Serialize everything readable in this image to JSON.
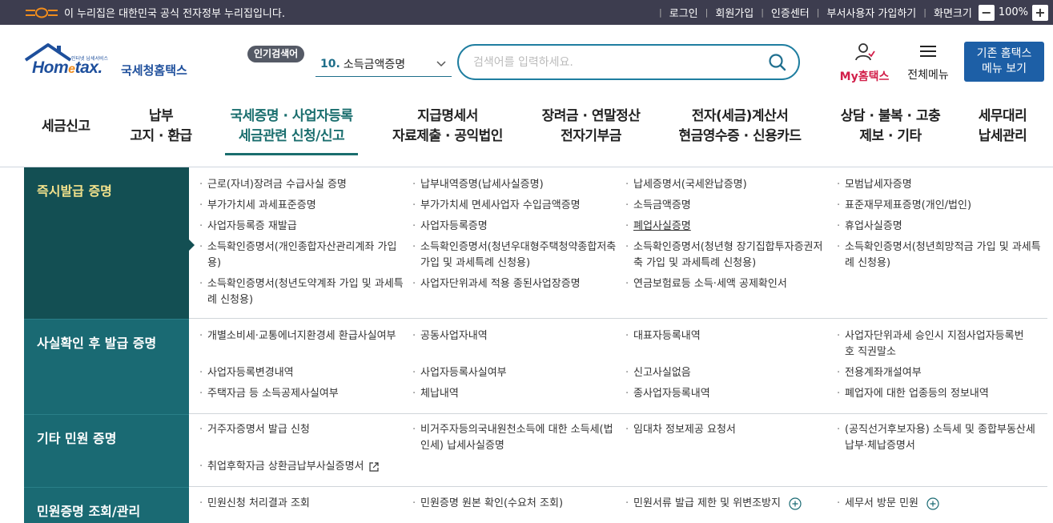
{
  "gov_bar": {
    "logo_text": "eG",
    "notice": "이 누리집은 대한민국 공식 전자정부 누리집입니다.",
    "links": [
      "로그인",
      "회원가입",
      "인증센터",
      "부서사용자 가입하기",
      "화면크기"
    ],
    "zoom_minus": "−",
    "zoom_value": "100%",
    "zoom_plus": "+"
  },
  "header": {
    "logo_tiny": "인터넷 납세서비스",
    "logo_brand_a": "Hom",
    "logo_brand_e": "e",
    "logo_brand_b": "tax.",
    "logo_kor": "국세청홈택스",
    "popular_label": "인기검색어",
    "popular_rank": "10.",
    "popular_term": "소득금액증명",
    "search_placeholder": "검색어를 입력하세요.",
    "my_hometax": "My홈택스",
    "all_menu": "전체메뉴",
    "old_home_line1": "기존 홈택스",
    "old_home_line2": "메뉴 보기"
  },
  "gnb": [
    {
      "l1": "세금신고",
      "l2": ""
    },
    {
      "l1": "납부",
      "l2": "고지 · 환급"
    },
    {
      "l1": "국세증명 · 사업자등록",
      "l2": "세금관련 신청/신고"
    },
    {
      "l1": "지급명세서",
      "l2": "자료제출 · 공익법인"
    },
    {
      "l1": "장려금 · 연말정산",
      "l2": "전자기부금"
    },
    {
      "l1": "전자(세금)계산서",
      "l2": "현금영수증 · 신용카드"
    },
    {
      "l1": "상담 · 불복 · 고충",
      "l2": "제보 · 기타"
    },
    {
      "l1": "세무대리",
      "l2": "납세관리"
    }
  ],
  "categories": [
    "즉시발급 증명",
    "사실확인 후 발급 증명",
    "기타 민원 증명",
    "민원증명 조회/관리"
  ],
  "items": {
    "c1": [
      "근로(자녀)장려금 수급사실 증명",
      "납부내역증명(납세사실증명)",
      "납세증명서(국세완납증명)",
      "모범납세자증명",
      "부가가치세 과세표준증명",
      "부가가치세 면세사업자 수입금액증명",
      "소득금액증명",
      "표준재무제표증명(개인/법인)",
      "사업자등록증 재발급",
      "사업자등록증명",
      "폐업사실증명",
      "휴업사실증명",
      "소득확인증명서(개인종합자산관리계좌 가입용)",
      "소득확인증명서(청년우대형주택청약종합저축 가입 및 과세특례 신청용)",
      "소득확인증명서(청년형 장기집합투자증권저축 가입 및 과세특례 신청용)",
      "소득확인증명서(청년희망적금 가입 및 과세특례 신청용)",
      "소득확인증명서(청년도약계좌 가입 및 과세특례 신청용)",
      "사업자단위과세 적용 종된사업장증명",
      "연금보험료등 소득·세액 공제확인서"
    ],
    "c2": [
      "개별소비세·교통에너지환경세 환급사실여부",
      "공동사업자내역",
      "대표자등록내역",
      "사업자단위과세 승인시 지점사업자등록번호 직권말소",
      "사업자등록변경내역",
      "사업자등록사실여부",
      "신고사실없음",
      "전용계좌개설여부",
      "주택자금 등 소득공제사실여부",
      "체납내역",
      "종사업자등록내역",
      "폐업자에 대한 업종등의 정보내역"
    ],
    "c3": [
      "거주자증명서 발급 신청",
      "비거주자등의국내원천소득에 대한 소득세(법인세) 납세사실증명",
      "임대차 정보제공 요청서",
      "(공직선거후보자용) 소득세 및 종합부동산세 납부·체납증명서",
      "취업후학자금 상환금납부사실증명서"
    ],
    "c4": [
      "민원신청 처리결과 조회",
      "민원증명 원본 확인(수요처 조회)",
      "민원서류 발급 제한 및 위변조방지",
      "세무서 방문 민원"
    ]
  },
  "colors": {
    "gov_bar": "#3d3d4f",
    "brand_blue": "#1e4f9c",
    "accent_teal": "#1a6e6e",
    "category_bg": "#1a6a73",
    "category_active_bg": "#134f53",
    "category_active_text": "#f3e28c",
    "my_hometax": "#d21f4a"
  }
}
